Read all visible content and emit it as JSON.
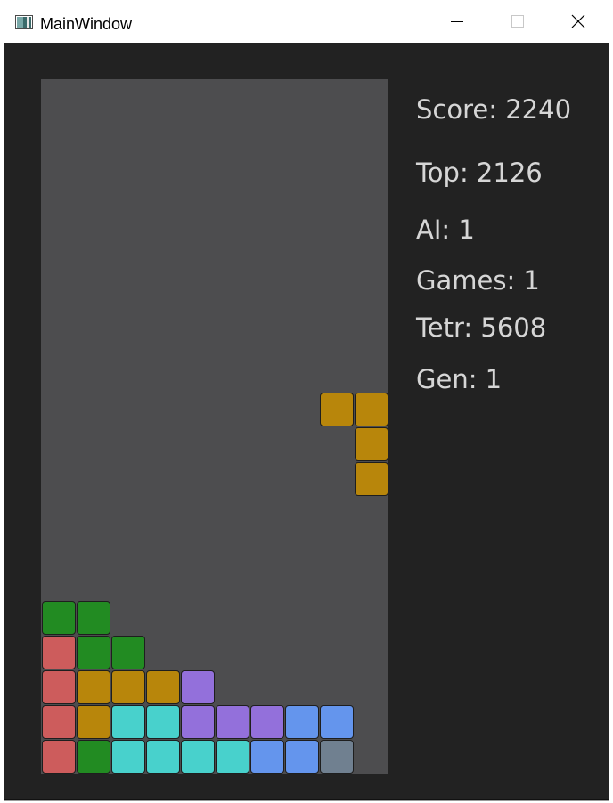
{
  "window": {
    "title": "MainWindow",
    "icon": "app-window-icon",
    "controls": [
      "minimize-icon",
      "maximize-icon",
      "close-icon"
    ]
  },
  "board": {
    "cols": 10,
    "rows": 20,
    "background": "#4d4d4f",
    "colors": {
      "G": "#228b22",
      "R": "#cd5c5c",
      "Y": "#b8860b",
      "C": "#48d1cc",
      "P": "#9370db",
      "B": "#6495ed",
      "S": "#708090"
    },
    "grid": [
      "..........",
      "..........",
      "..........",
      "..........",
      "..........",
      "..........",
      "..........",
      "..........",
      "..........",
      "........YY",
      ".........Y",
      ".........Y",
      "..........",
      "..........",
      "..........",
      "GG........",
      "RGG.......",
      "RYYYP.....",
      "RYCCPPPBB.",
      "RGCCCCBBS."
    ]
  },
  "stats": {
    "score": "Score: 2240",
    "top": "Top: 2126",
    "ai": "AI: 1",
    "games": "Games: 1",
    "tetr": "Tetr: 5608",
    "gen": "Gen: 1"
  }
}
